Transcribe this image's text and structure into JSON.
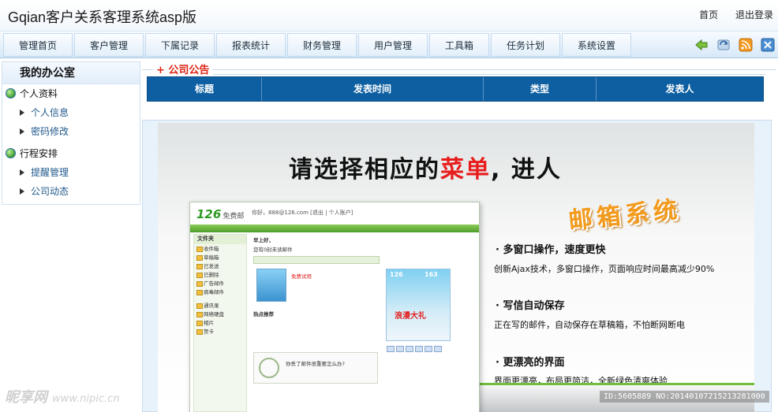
{
  "app": {
    "title": "Gqian客户关系客理系统asp版"
  },
  "top_links": {
    "home": "首页",
    "logout": "退出登录"
  },
  "nav": {
    "items": [
      "管理首页",
      "客户管理",
      "下属记录",
      "报表统计",
      "财务管理",
      "用户管理",
      "工具箱",
      "任务计划",
      "系统设置"
    ]
  },
  "nav_icons": [
    "back-arrow-icon",
    "refresh-icon",
    "rss-icon",
    "close-icon"
  ],
  "sidebar": {
    "title": "我的办公室",
    "groups": [
      {
        "label": "个人资料",
        "items": [
          "个人信息",
          "密码修改"
        ]
      },
      {
        "label": "行程安排",
        "items": [
          "提醒管理",
          "公司动态"
        ]
      }
    ]
  },
  "notice": {
    "title": "+ 公司公告",
    "columns": [
      "标题",
      "发表时间",
      "类型",
      "发表人"
    ]
  },
  "banner": {
    "headline_pre": "请选择相应的",
    "headline_red": "菜单",
    "headline_post": ", 进人",
    "mail_system": "邮箱系统",
    "features": [
      {
        "title": "· 多窗口操作，速度更快",
        "desc": "创新Ajax技术，多窗口操作，页面响应时间最高减少90%"
      },
      {
        "title": "· 写信自动保存",
        "desc": "正在写的邮件，自动保存在草稿箱，不怕断网断电"
      },
      {
        "title": "· 更漂亮的界面",
        "desc": "界面更漂亮，布局更简洁，全新绿色清爽体验"
      }
    ],
    "mock": {
      "logo": "126",
      "logo_sub": "免费邮",
      "top_text": "你好，888@126.com [退出 | 个人账户]",
      "side_head": "文件夹",
      "side_items": [
        "收件箱",
        "草稿箱",
        "已发送",
        "已删除",
        "广告邮件",
        "病毒邮件",
        "通讯录",
        "网络硬盘",
        "相片",
        "贺卡"
      ],
      "lines": [
        "早上好，",
        "您有0封未读邮件",
        "免费试用",
        "热点推荐",
        "你丢了邮件很重要怎么办?"
      ],
      "ad_big": "浪漫大礼",
      "ad_num1": "126",
      "ad_num2": "163"
    }
  },
  "watermark": {
    "left": "昵享网",
    "left_url": "www.nipic.cn",
    "right": "ID:5605889 NO:20140107215213281000"
  },
  "colors": {
    "notice_header_bg": "#0d5fa1",
    "notice_title": "#dd2211",
    "headline_red": "#e81c1c",
    "mail_system_orange": "#f39a1b"
  }
}
